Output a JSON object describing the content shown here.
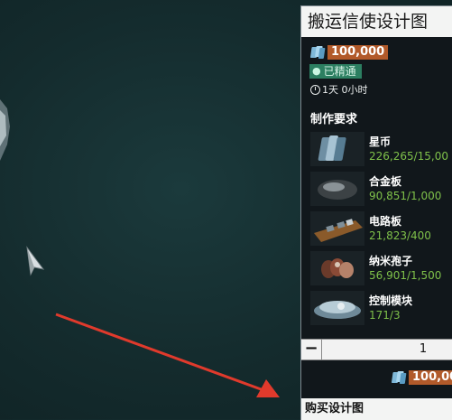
{
  "blueprint_panel": {
    "title": "搬运信使设计图",
    "price": "100,000",
    "mastered_label": "已精通",
    "build_time": "1天 0小时",
    "requirements_header": "制作要求",
    "requirements": [
      {
        "name": "星币",
        "amount": "226,265/15,00",
        "icon": "credits-icon"
      },
      {
        "name": "合金板",
        "amount": "90,851/1,000",
        "icon": "alloy-plate-icon"
      },
      {
        "name": "电路板",
        "amount": "21,823/400",
        "icon": "circuit-board-icon"
      },
      {
        "name": "纳米孢子",
        "amount": "56,901/1,500",
        "icon": "nano-spore-icon"
      },
      {
        "name": "控制模块",
        "amount": "171/3",
        "icon": "control-module-icon"
      }
    ],
    "quantity": "1",
    "minus_label": "−",
    "total_price": "100,00",
    "buy_button_label": "购买设计图"
  },
  "colors": {
    "price_bg": "#b25a2a",
    "mastered_bg": "#2c7f61",
    "amount_green": "#7fc14a",
    "annotation_arrow": "#e03a2c"
  }
}
